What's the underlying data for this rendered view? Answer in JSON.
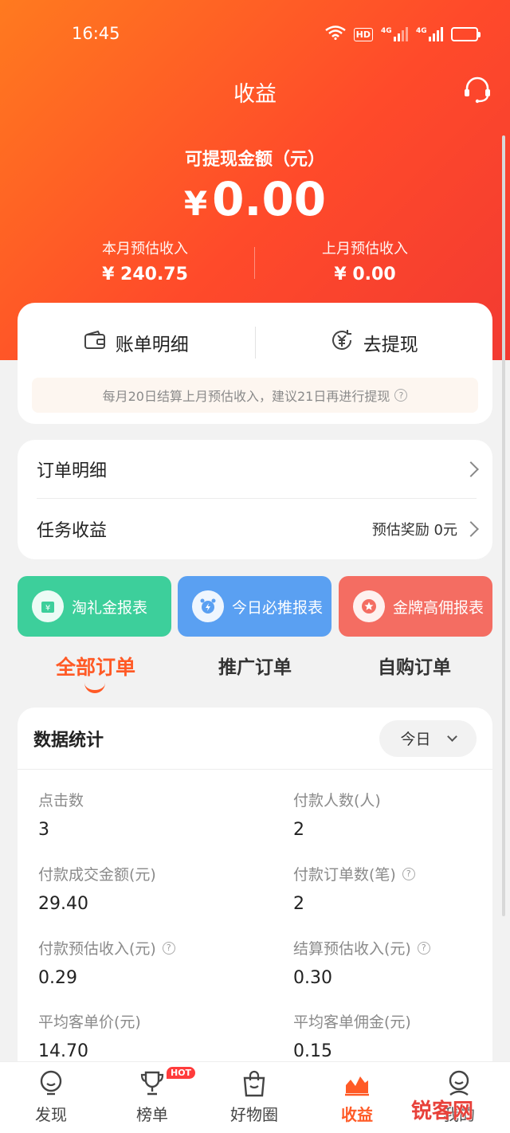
{
  "status": {
    "time": "16:45",
    "net1": "4G",
    "net2": "4G",
    "hd": "HD"
  },
  "header": {
    "title": "收益"
  },
  "balance": {
    "label": "可提现金额（元）",
    "currency": "¥",
    "amount": "0.00"
  },
  "monthly": {
    "this_label": "本月预估收入",
    "this_value": "¥ 240.75",
    "last_label": "上月预估收入",
    "last_value": "¥ 0.00"
  },
  "bill": {
    "detail_label": "账单明细",
    "withdraw_label": "去提现",
    "notice": "每月20日结算上月预估收入，建议21日再进行提现"
  },
  "list": {
    "orders_label": "订单明细",
    "task_label": "任务收益",
    "task_value": "预估奖励 0元"
  },
  "reports": {
    "r1": "淘礼金报表",
    "r2": "今日必推报表",
    "r3": "金牌高佣报表"
  },
  "tabs": {
    "all": "全部订单",
    "promo": "推广订单",
    "self": "自购订单"
  },
  "stats": {
    "title": "数据统计",
    "range": "今日",
    "items": [
      {
        "label": "点击数",
        "value": "3"
      },
      {
        "label": "付款人数(人)",
        "value": "2"
      },
      {
        "label": "付款成交金额(元)",
        "value": "29.40"
      },
      {
        "label": "付款订单数(笔)",
        "value": "2"
      },
      {
        "label": "付款预估收入(元)",
        "value": "0.29"
      },
      {
        "label": "结算预估收入(元)",
        "value": "0.30"
      },
      {
        "label": "平均客单价(元)",
        "value": "14.70"
      },
      {
        "label": "平均客单佣金(元)",
        "value": "0.15"
      }
    ]
  },
  "nav": {
    "discover": "发现",
    "ranking": "榜单",
    "hot": "HOT",
    "goods": "好物圈",
    "income": "收益",
    "mine": "我的"
  },
  "watermark": "锐客网",
  "colors": {
    "accent": "#ff5a26",
    "hero_start": "#ff7a1f",
    "hero_end": "#f23a32"
  }
}
